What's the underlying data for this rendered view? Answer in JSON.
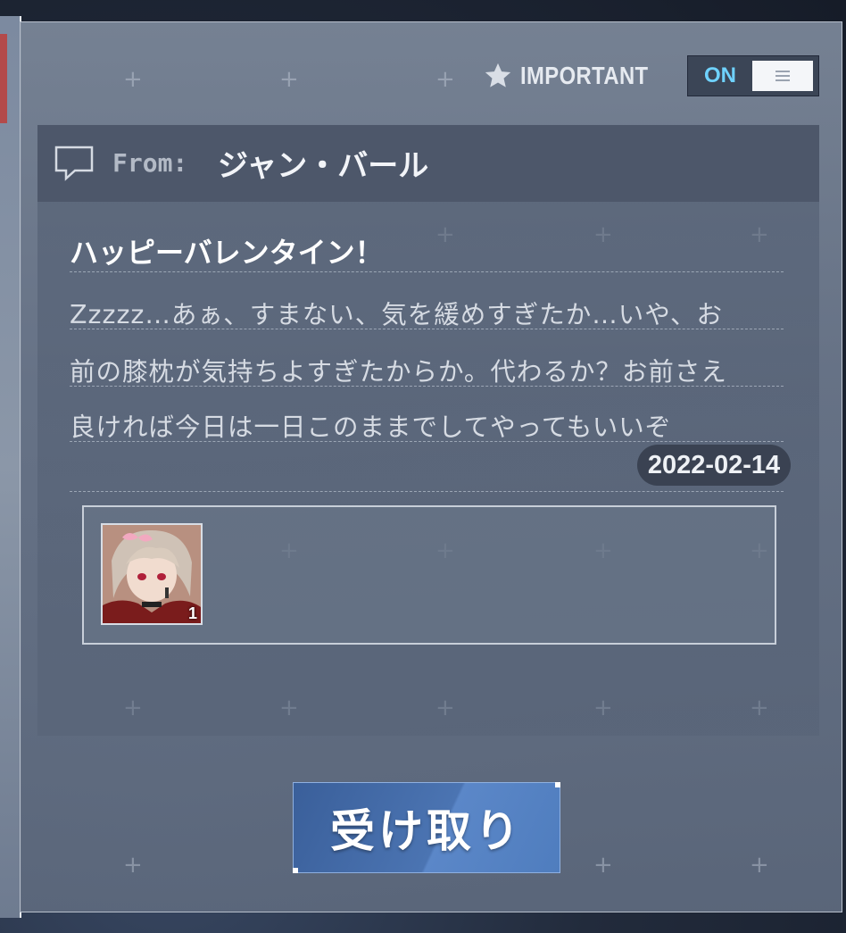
{
  "important": {
    "label": "IMPORTANT",
    "icon": "star-icon"
  },
  "toggle": {
    "state_label": "ON",
    "handle_icon": "menu-lines-icon"
  },
  "mail": {
    "from_label": "From:",
    "sender": "ジャン・バール",
    "subject": "ハッピーバレンタイン！",
    "body_lines": [
      "Zzzzz…あぁ、すまない、気を緩めすぎたか…いや、お",
      "前の膝枕が気持ちよすぎたからか。代わるか？お前さえ",
      "良ければ今日は一日このままでしてやってもいいぞ"
    ],
    "date": "2022-02-14"
  },
  "attachment": {
    "quantity": "1",
    "icon": "character-portrait-icon"
  },
  "receive_button": {
    "label": "受け取り"
  },
  "colors": {
    "accent_on": "#6fd2ff",
    "button": "#4b74b2",
    "panel": "#6a768a"
  }
}
